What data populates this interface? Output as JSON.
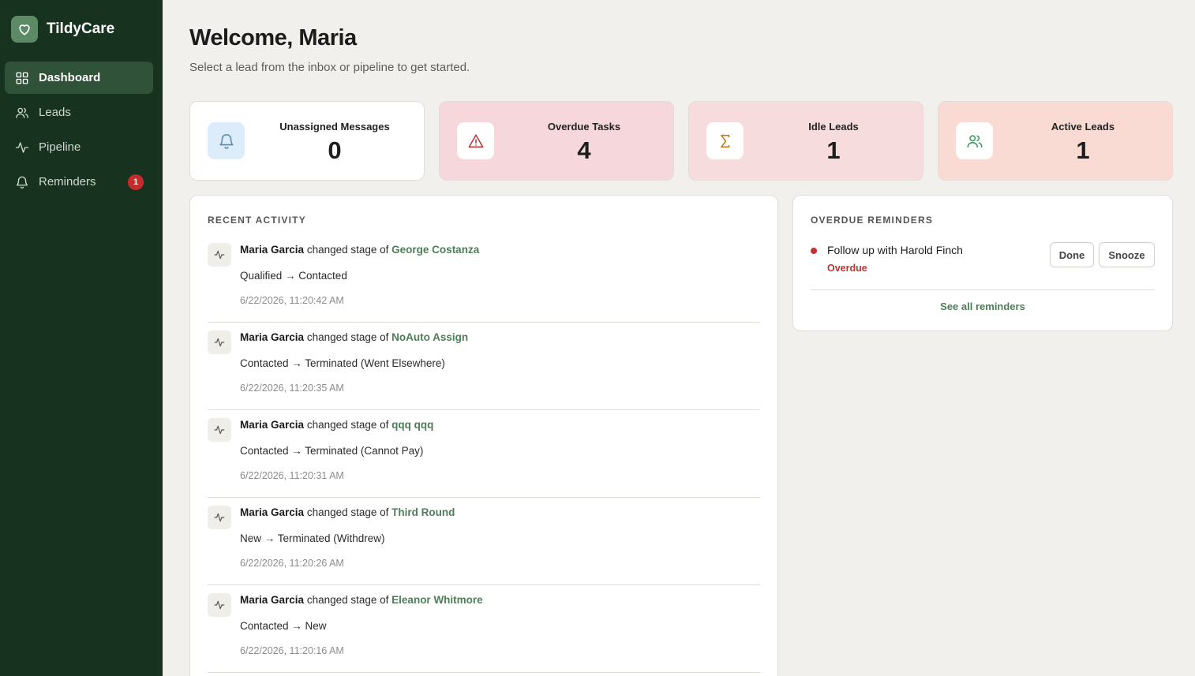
{
  "app": {
    "name": "TildyCare"
  },
  "sidebar": {
    "items": [
      {
        "label": "Dashboard",
        "icon": "grid-icon",
        "active": true
      },
      {
        "label": "Leads",
        "icon": "users-icon",
        "active": false
      },
      {
        "label": "Pipeline",
        "icon": "activity-icon",
        "active": false
      },
      {
        "label": "Reminders",
        "icon": "bell-icon",
        "active": false,
        "badge": "1"
      }
    ]
  },
  "header": {
    "title": "Welcome, Maria",
    "subtitle": "Select a lead from the inbox or pipeline to get started."
  },
  "stats": [
    {
      "label": "Unassigned Messages",
      "value": "0",
      "icon": "bell-icon",
      "card_color": "#ffffff",
      "icon_bg": "#dcecfa",
      "icon_color": "#5f87a8"
    },
    {
      "label": "Overdue Tasks",
      "value": "4",
      "icon": "alert-triangle-icon",
      "card_color": "#f6d7dc",
      "icon_bg": "#ffffff",
      "icon_color": "#b73a3a"
    },
    {
      "label": "Idle Leads",
      "value": "1",
      "icon": "sigma-icon",
      "card_color": "#f6dcdc",
      "icon_bg": "#ffffff",
      "icon_color": "#c07a16"
    },
    {
      "label": "Active Leads",
      "value": "1",
      "icon": "users-icon",
      "card_color": "#fadbd3",
      "icon_bg": "#ffffff",
      "icon_color": "#3f9a58"
    }
  ],
  "activity": {
    "title": "RECENT ACTIVITY",
    "items": [
      {
        "actor": "Maria Garcia",
        "action": "changed stage of",
        "lead": "George Costanza",
        "detail": "Qualified → Contacted",
        "time": "6/22/2026, 11:20:42 AM"
      },
      {
        "actor": "Maria Garcia",
        "action": "changed stage of",
        "lead": "NoAuto Assign",
        "detail": "Contacted → Terminated (Went Elsewhere)",
        "time": "6/22/2026, 11:20:35 AM"
      },
      {
        "actor": "Maria Garcia",
        "action": "changed stage of",
        "lead": "qqq qqq",
        "detail": "Contacted → Terminated (Cannot Pay)",
        "time": "6/22/2026, 11:20:31 AM"
      },
      {
        "actor": "Maria Garcia",
        "action": "changed stage of",
        "lead": "Third Round",
        "detail": "New → Terminated (Withdrew)",
        "time": "6/22/2026, 11:20:26 AM"
      },
      {
        "actor": "Maria Garcia",
        "action": "changed stage of",
        "lead": "Eleanor Whitmore",
        "detail": "Contacted → New",
        "time": "6/22/2026, 11:20:16 AM"
      }
    ]
  },
  "reminders": {
    "title": "OVERDUE REMINDERS",
    "items": [
      {
        "title": "Follow up with Harold Finch",
        "status": "Overdue",
        "done_label": "Done",
        "snooze_label": "Snooze"
      }
    ],
    "see_all_label": "See all reminders"
  },
  "colors": {
    "sidebar": "#17331f",
    "accent": "#4e7d58",
    "danger": "#c23232"
  }
}
